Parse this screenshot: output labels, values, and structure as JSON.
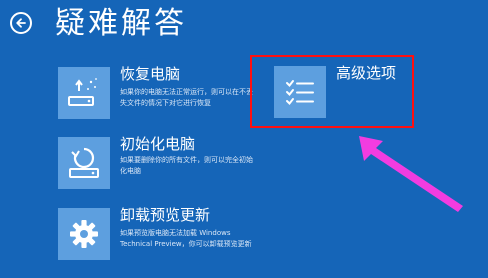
{
  "header": {
    "title": "疑难解答",
    "back_icon": "back-arrow-icon"
  },
  "options": [
    {
      "id": "restore",
      "title": "恢复电脑",
      "description": "如果你的电脑无法正常运行，则可以在不丢失文件的情况下对它进行恢复",
      "icon": "refresh-pc-icon"
    },
    {
      "id": "reset",
      "title": "初始化电脑",
      "description": "如果要删除你的所有文件，则可以完全初始化电脑",
      "icon": "reset-pc-icon"
    },
    {
      "id": "uninstall",
      "title": "卸载预览更新",
      "description": "如果预览版电脑无法加载 Windows Technical Preview，你可以卸载预览更新",
      "icon": "gear-icon"
    },
    {
      "id": "advanced",
      "title": "高级选项",
      "description": "",
      "icon": "checklist-icon"
    }
  ],
  "colors": {
    "background": "#1565b8",
    "tile": "#5d9fdf",
    "highlight_box": "#ff1010",
    "annotation_arrow": "#f23ce0"
  }
}
